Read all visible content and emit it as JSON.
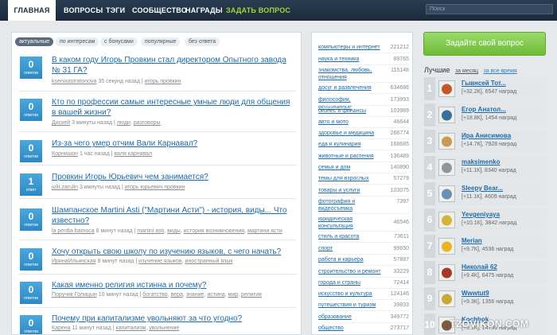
{
  "nav": {
    "tabs": [
      "ГЛАВНАЯ",
      "ВОПРОСЫ",
      "ТЭГИ",
      "СООБЩЕСТВО",
      "НАГРАДЫ"
    ],
    "ask": "ЗАДАТЬ ВОПРОС",
    "search_placeholder": "Поиск"
  },
  "filters": [
    "актуальные",
    "по интересам",
    "с бонусами",
    "популярные",
    "без ответа"
  ],
  "questions": [
    {
      "count": "0",
      "count_label": "ответов",
      "title": "В каком году Игорь Провкин стал директором Опытного завода № 31 ГА?",
      "author": "ksenixastratonova",
      "time": "35 секунд назад",
      "tags": [
        "игорь провкин"
      ]
    },
    {
      "count": "0",
      "count_label": "ответов",
      "title": "Кто по профессии самые интересные умные люди для общения в вашей жизни?",
      "author": "Дискей",
      "time": "3 минуты назад",
      "tags": [
        "люди",
        "разговоры"
      ]
    },
    {
      "count": "0",
      "count_label": "ответов",
      "title": "Из-за чего умер отчим Вали Карнавал?",
      "author": "Корнишон",
      "time": "1 час назад",
      "tags": [
        "валя карнавал"
      ]
    },
    {
      "count": "1",
      "count_label": "ответ",
      "title": "Провкин Игорь Юрьевич чем занимается?",
      "author": "julit.zarulin",
      "time": "3 минуты назад",
      "tags": [
        "игорь юрьевич провкин"
      ]
    },
    {
      "count": "0",
      "count_label": "ответов",
      "title": "Шампанское Martini Asti (\"Мартини Асти\") - история, виды... Что известно?",
      "author": "la perdia bamoca",
      "time": "8 минут назад",
      "tags": [
        "martini asti",
        "виды",
        "история возникновения",
        "мартини асти"
      ]
    },
    {
      "count": "0",
      "count_label": "ответов",
      "title": "Хочу открыть свою школу по изучению языков, с чего начать?",
      "author": "ИринаИльинская",
      "time": "9 минут назад",
      "tags": [
        "изучение языков",
        "иностранный язык"
      ]
    },
    {
      "count": "0",
      "count_label": "ответов",
      "title": "Какая именно религия истинна и почему?",
      "author": "Поручик Голицын",
      "time": "10 минут назад",
      "tags": [
        "богатство",
        "вера",
        "знание",
        "истина",
        "мир",
        "религия"
      ]
    },
    {
      "count": "0",
      "count_label": "ответов",
      "title": "Почему при капитализме увольняют за что угодно?",
      "author": "Карена",
      "time": "11 минут назад",
      "tags": [
        "капитализм",
        "увольнение"
      ]
    }
  ],
  "categories": [
    {
      "name": "компьютеры и интернет",
      "count": "221212"
    },
    {
      "name": "наука и техника",
      "count": "89765"
    },
    {
      "name": "знакомства, любовь, отношения",
      "count": "115146"
    },
    {
      "name": "досуг и развлечения",
      "count": "634686"
    },
    {
      "name": "философия, непознанное",
      "count": "173993"
    },
    {
      "name": "бизнес и финансы",
      "count": "103989"
    },
    {
      "name": "авто и мото",
      "count": "46644"
    },
    {
      "name": "здоровье и медицина",
      "count": "266774"
    },
    {
      "name": "еда и кулинария",
      "count": "168685"
    },
    {
      "name": "животные и растения",
      "count": "136489"
    },
    {
      "name": "семья и дом",
      "count": "140890"
    },
    {
      "name": "темы для взрослых",
      "count": "57279"
    },
    {
      "name": "товары и услуги",
      "count": "103075"
    },
    {
      "name": "фотография и видеосъемка",
      "count": "7397"
    },
    {
      "name": "юридическая консультация",
      "count": "46546"
    },
    {
      "name": "стиль и красота",
      "count": "73611"
    },
    {
      "name": "спорт",
      "count": "99650"
    },
    {
      "name": "работа и карьера",
      "count": "57897"
    },
    {
      "name": "строительство и ремонт",
      "count": "33229"
    },
    {
      "name": "города и страны",
      "count": "72414"
    },
    {
      "name": "искусство и культура",
      "count": "124146"
    },
    {
      "name": "путешествия и туризм",
      "count": "39833"
    },
    {
      "name": "образование",
      "count": "349772"
    },
    {
      "name": "общество",
      "count": "273717"
    }
  ],
  "right": {
    "ask_button": "Задайте свой вопрос",
    "best_label": "Лучшие",
    "period_month": "за месяц",
    "period_all": "за все время",
    "leaders": [
      {
        "rank": "1",
        "name": "Гывнсей Тот...",
        "stats": "[+32.2К], 6547 наград",
        "color": "#c0582a"
      },
      {
        "rank": "2",
        "name": "Егор Анатол...",
        "stats": "[+18.8К], 1454 наград",
        "color": "#3a6f9a"
      },
      {
        "rank": "3",
        "name": "Ира Анисимова",
        "stats": "[+14.7К], 7928 наград",
        "color": "#c79a54"
      },
      {
        "rank": "4",
        "name": "maksimenko",
        "stats": "[+11.1К], 8340 наград",
        "color": "#8f969c"
      },
      {
        "rank": "5",
        "name": "Sleepy Bear...",
        "stats": "[+11.1К], 4609 наград",
        "color": "#6b8fb8"
      },
      {
        "rank": "6",
        "name": "Yevgeniyaya",
        "stats": "[+10.1К], 3842 наград",
        "color": "#d4b43a"
      },
      {
        "rank": "7",
        "name": "Merian",
        "stats": "[+9.7К], 4536 наград",
        "color": "#e8b325"
      },
      {
        "rank": "8",
        "name": "Николай 62",
        "stats": "[+9.4К], 6475 наград",
        "color": "#a33a2c"
      },
      {
        "rank": "9",
        "name": "Wwwtut9",
        "stats": "[+9.3К], 1356 наград",
        "color": "#c8a83a"
      },
      {
        "rank": "10",
        "name": "Kochbok",
        "stats": "[+9.1К], 14736 наград",
        "color": "#7a5a40"
      }
    ]
  },
  "watermark": "TZOVIKON.COM"
}
